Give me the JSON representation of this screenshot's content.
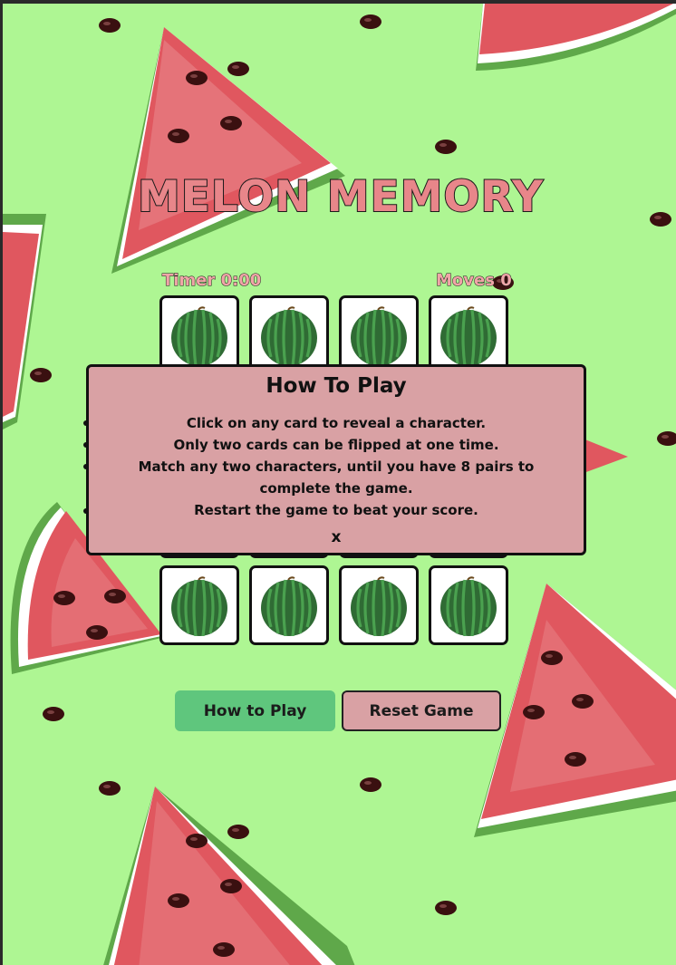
{
  "game": {
    "title": "MELON MEMORY",
    "timer_label": "Timer 0:00",
    "moves_label": "Moves 0",
    "card_count": 16,
    "card_face": "watermelon-icon"
  },
  "buttons": {
    "how_to_play": "How to Play",
    "reset": "Reset Game"
  },
  "modal": {
    "title": "How To Play",
    "lines": [
      "Click on any card to reveal a character.",
      "Only two cards can be flipped at one time.",
      "Match any two characters, until you have 8 pairs to complete the game.",
      "Restart the game to beat your score."
    ],
    "close": "x"
  },
  "colors": {
    "background": "#aef693",
    "melon_flesh": "#e8868a",
    "melon_dark": "#e0575f",
    "rind_green": "#5fa84a",
    "modal_bg": "#d9a1a4",
    "button_green": "#5fc67d"
  }
}
